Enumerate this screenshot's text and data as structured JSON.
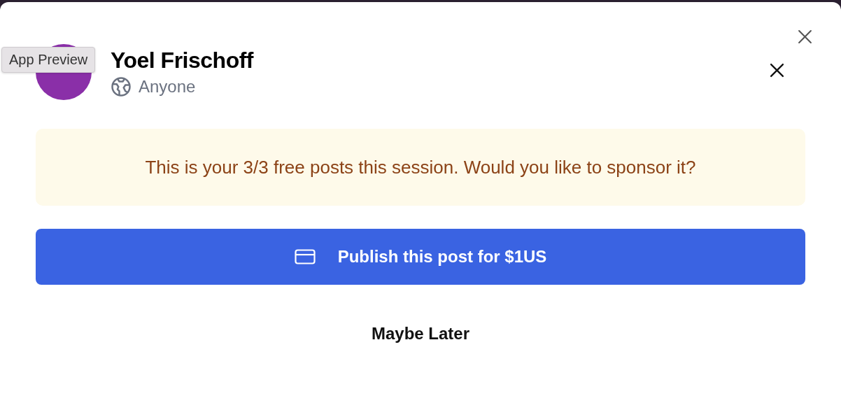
{
  "tooltip": {
    "text": "App Preview"
  },
  "author": {
    "name": "Yoel Frischoff",
    "audience": "Anyone"
  },
  "notice": {
    "text": "This is your 3/3 free posts this session. Would you like to sponsor it?"
  },
  "primary_button": {
    "label": "Publish this post for $1US"
  },
  "secondary_button": {
    "label": "Maybe Later"
  }
}
